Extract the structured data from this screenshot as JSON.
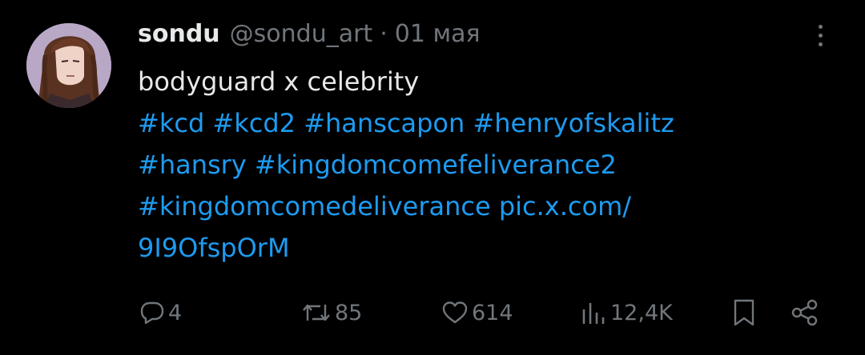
{
  "tweet": {
    "display_name": "sondu",
    "handle": "@sondu_art",
    "separator": "·",
    "date": "01 мая",
    "text_line": "bodyguard x celebrity",
    "hashtags_line1": [
      "#kcd",
      "#kcd2",
      "#hanscapon",
      "#henryofskalitz"
    ],
    "hashtags_line2": [
      "#hansry",
      "#kingdomcomefeliverance2"
    ],
    "hashtag_line3": "#kingdomcomedeliverance",
    "link_part1": "pic.x.com/",
    "link_part2": "9I9OfspOrM"
  },
  "actions": {
    "replies": "4",
    "retweets": "85",
    "likes": "614",
    "views": "12,4K"
  },
  "icons": {
    "reply": "speech-bubble-icon",
    "retweet": "retweet-arrows-icon",
    "like": "heart-icon",
    "views": "bar-chart-icon",
    "bookmark": "bookmark-icon",
    "share": "share-icon",
    "more": "more-vertical-icon"
  },
  "colors": {
    "background": "#000000",
    "text": "#e7e9ea",
    "muted": "#71767b",
    "link": "#1d9bf0"
  }
}
